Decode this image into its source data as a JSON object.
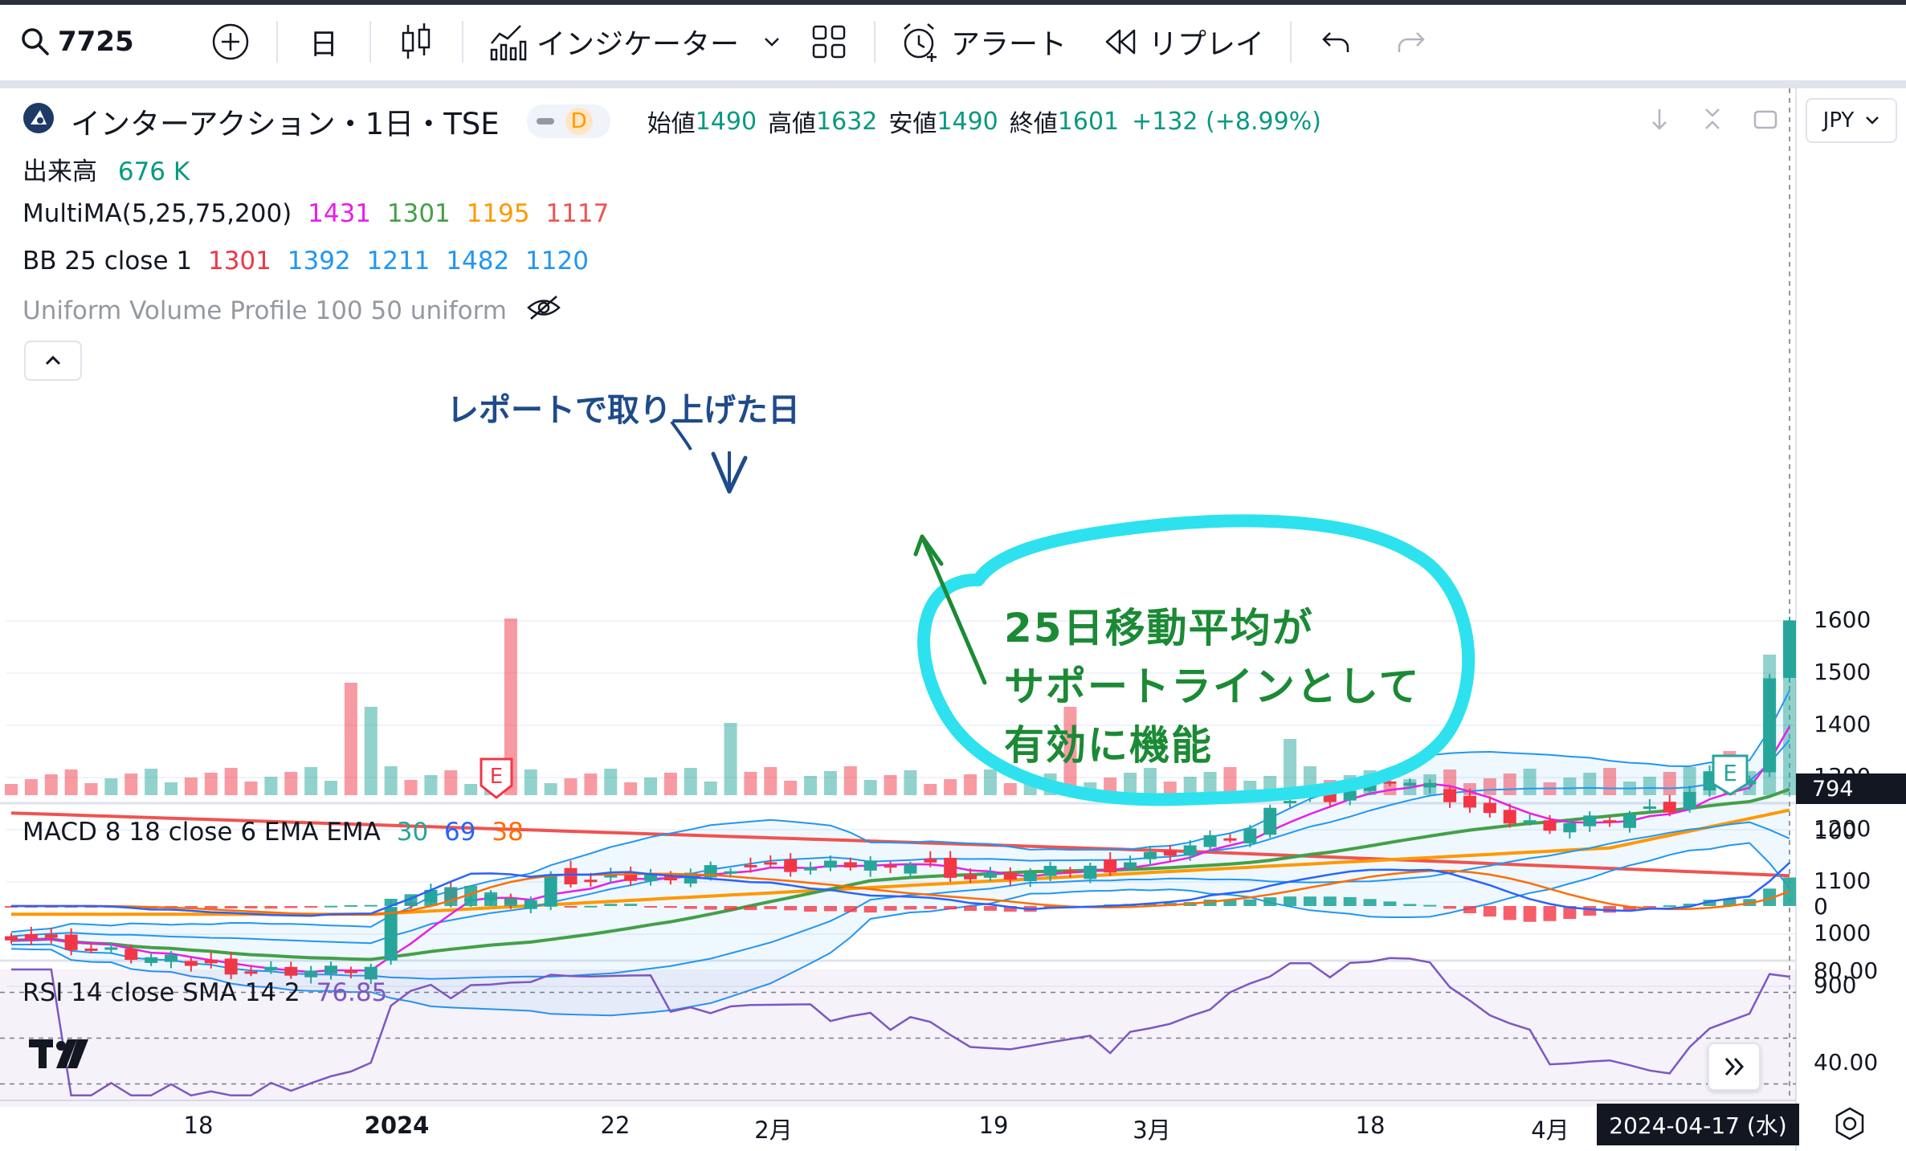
{
  "toolbar": {
    "symbol": "7725",
    "interval": "日",
    "indicators_label": "インジケーター",
    "alert_label": "アラート",
    "replay_label": "リプレイ"
  },
  "header": {
    "title": "インターアクション・1日・TSE",
    "badge": "D",
    "open_label": "始値",
    "open": "1490",
    "high_label": "高値",
    "high": "1632",
    "low_label": "安値",
    "low": "1490",
    "close_label": "終値",
    "close": "1601",
    "change": "+132 (+8.99%)",
    "currency": "JPY"
  },
  "legends": {
    "volume_label": "出来高",
    "volume_value": "676 K",
    "ma_label": "MultiMA(5,25,75,200)",
    "ma_v1": "1431",
    "ma_v2": "1301",
    "ma_v3": "1195",
    "ma_v4": "1117",
    "bb_label": "BB 25 close 1",
    "bb_v1": "1301",
    "bb_v2": "1392",
    "bb_v3": "1211",
    "bb_v4": "1482",
    "bb_v5": "1120",
    "vp_label": "Uniform Volume Profile 100 50 uniform",
    "macd_label": "MACD 8 18 close 6 EMA EMA",
    "macd_v1": "30",
    "macd_v2": "69",
    "macd_v3": "38",
    "rsi_label": "RSI 14 close SMA 14 2",
    "rsi_v": "76.85"
  },
  "price_axis": [
    "1600",
    "1500",
    "1400",
    "1300",
    "1200",
    "1100",
    "1000",
    "900"
  ],
  "volume_marker": "794",
  "macd_axis": [
    "100",
    "0"
  ],
  "rsi_axis": [
    "80.00",
    "40.00"
  ],
  "time_axis": [
    "18",
    "2024",
    "22",
    "2月",
    "19",
    "3月",
    "18",
    "4月"
  ],
  "date_cursor": "2024-04-17 (水)",
  "earnings_marker": "E",
  "annotations": {
    "note1": "レポートで取り上げた日",
    "note2_line1": "25日移動平均が",
    "note2_line2": "サポートラインとして",
    "note2_line3": "有効に機能"
  },
  "colors": {
    "up": "#26a69a",
    "down": "#f23645",
    "ma5": "#e91ee9",
    "ma25": "#43a047",
    "ma75": "#ff9800",
    "ma200": "#f05350",
    "bb": "#2196f3",
    "macd": "#2962ff",
    "signal": "#ff6d00",
    "rsi": "#7e57c2",
    "note_blue": "#1e4b8a",
    "note_green": "#1b8a35",
    "highlight": "#2de2ee"
  }
}
